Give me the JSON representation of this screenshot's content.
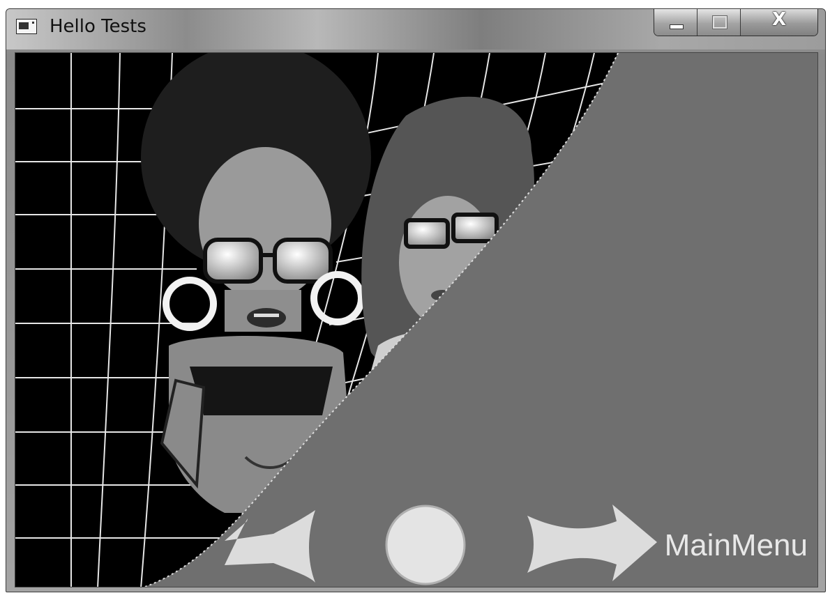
{
  "window": {
    "title": "Hello Tests",
    "controls": {
      "minimize": "minimize-icon",
      "maximize": "maximize-icon",
      "close_label": "X"
    }
  },
  "scene": {
    "description_icons": [
      "app-icon"
    ],
    "nav": {
      "back": "back-arrow-icon",
      "restart": "restart-circle-icon",
      "next": "next-arrow-icon",
      "label": "MainMenu"
    }
  },
  "colors": {
    "background": "#6f6f6f",
    "page_black": "#000000",
    "grid_line": "#e6e6e6",
    "nav_fill": "#e2e2e2"
  }
}
